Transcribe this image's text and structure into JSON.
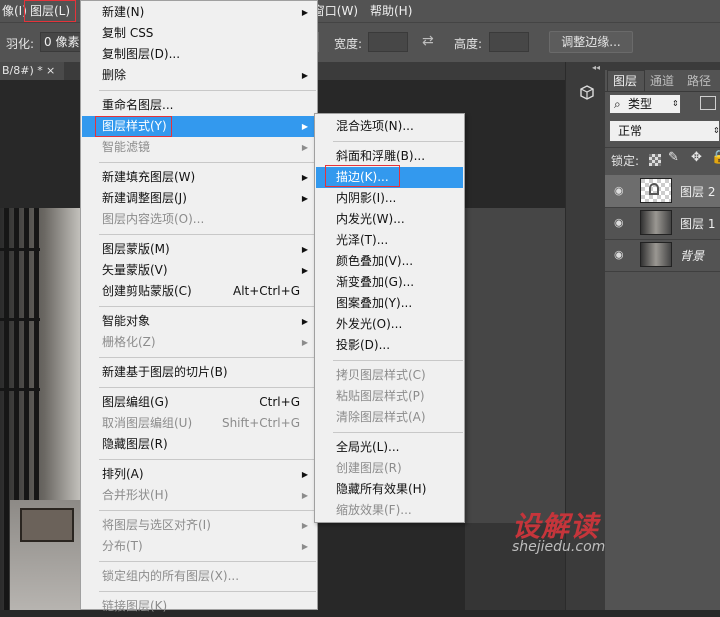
{
  "menubar": {
    "items": [
      {
        "label": "像(I)"
      },
      {
        "label": "图层(L)"
      },
      {
        "label": "窗口(W)"
      },
      {
        "label": "帮助(H)"
      }
    ]
  },
  "options_bar": {
    "feather_label": "羽化:",
    "feather_value": "0 像素",
    "width_label": "宽度:",
    "height_label": "高度:",
    "refine_edge_button": "调整边缘..."
  },
  "document": {
    "tab_label": "B/8#) *",
    "tab_close": "×"
  },
  "layer_menu": {
    "items": [
      {
        "label": "新建(N)",
        "submenu": true
      },
      {
        "label": "复制 CSS"
      },
      {
        "label": "复制图层(D)..."
      },
      {
        "label": "删除",
        "submenu": true
      },
      {
        "separator": true
      },
      {
        "label": "重命名图层..."
      },
      {
        "label": "图层样式(Y)",
        "submenu": true,
        "highlighted": true
      },
      {
        "label": "智能滤镜",
        "submenu": true,
        "disabled": true
      },
      {
        "separator": true
      },
      {
        "label": "新建填充图层(W)",
        "submenu": true
      },
      {
        "label": "新建调整图层(J)",
        "submenu": true
      },
      {
        "label": "图层内容选项(O)...",
        "disabled": true
      },
      {
        "separator": true
      },
      {
        "label": "图层蒙版(M)",
        "submenu": true
      },
      {
        "label": "矢量蒙版(V)",
        "submenu": true
      },
      {
        "label": "创建剪贴蒙版(C)",
        "shortcut": "Alt+Ctrl+G"
      },
      {
        "separator": true
      },
      {
        "label": "智能对象",
        "submenu": true
      },
      {
        "label": "栅格化(Z)",
        "submenu": true,
        "disabled": true
      },
      {
        "separator": true
      },
      {
        "label": "新建基于图层的切片(B)"
      },
      {
        "separator": true
      },
      {
        "label": "图层编组(G)",
        "shortcut": "Ctrl+G"
      },
      {
        "label": "取消图层编组(U)",
        "shortcut": "Shift+Ctrl+G",
        "disabled": true
      },
      {
        "label": "隐藏图层(R)"
      },
      {
        "separator": true
      },
      {
        "label": "排列(A)",
        "submenu": true
      },
      {
        "label": "合并形状(H)",
        "submenu": true,
        "disabled": true
      },
      {
        "separator": true
      },
      {
        "label": "将图层与选区对齐(I)",
        "submenu": true,
        "disabled": true
      },
      {
        "label": "分布(T)",
        "submenu": true,
        "disabled": true
      },
      {
        "separator": true
      },
      {
        "label": "锁定组内的所有图层(X)...",
        "disabled": true
      },
      {
        "separator": true
      },
      {
        "label": "链接图层(K)",
        "disabled": true
      }
    ]
  },
  "style_submenu": {
    "items": [
      {
        "label": "混合选项(N)..."
      },
      {
        "separator": true
      },
      {
        "label": "斜面和浮雕(B)..."
      },
      {
        "label": "描边(K)...",
        "highlighted": true
      },
      {
        "label": "内阴影(I)..."
      },
      {
        "label": "内发光(W)..."
      },
      {
        "label": "光泽(T)..."
      },
      {
        "label": "颜色叠加(V)..."
      },
      {
        "label": "渐变叠加(G)..."
      },
      {
        "label": "图案叠加(Y)..."
      },
      {
        "label": "外发光(O)..."
      },
      {
        "label": "投影(D)..."
      },
      {
        "separator": true
      },
      {
        "label": "拷贝图层样式(C)",
        "disabled": true
      },
      {
        "label": "粘贴图层样式(P)",
        "disabled": true
      },
      {
        "label": "清除图层样式(A)",
        "disabled": true
      },
      {
        "separator": true
      },
      {
        "label": "全局光(L)..."
      },
      {
        "label": "创建图层(R)",
        "disabled": true
      },
      {
        "label": "隐藏所有效果(H)"
      },
      {
        "label": "缩放效果(F)...",
        "disabled": true
      }
    ]
  },
  "layers_panel": {
    "tabs": [
      "图层",
      "通道",
      "路径"
    ],
    "filter_label": "类型",
    "blend_mode": "正常",
    "lock_label": "锁定:",
    "layers": [
      {
        "name": "图层 2"
      },
      {
        "name": "图层 1"
      },
      {
        "name": "背景"
      }
    ]
  },
  "watermark": {
    "title": "设解读",
    "url": "shejiedu.com"
  },
  "colors": {
    "highlight": "#3399ee",
    "red_outline": "#e5333a",
    "menu_bg": "#f0f0f0",
    "chrome": "#535353"
  }
}
